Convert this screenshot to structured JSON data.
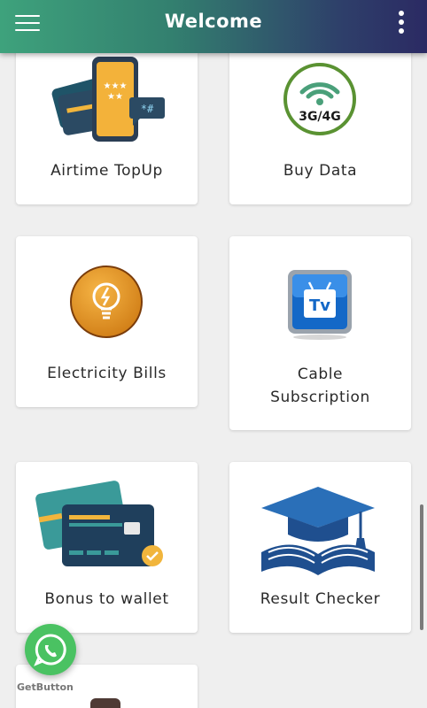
{
  "header": {
    "title": "Welcome",
    "menu_icon": "hamburger-menu-icon",
    "more_icon": "more-vert-icon"
  },
  "services": [
    {
      "label": "Airtime TopUp",
      "icon": "airtime-phone-icon"
    },
    {
      "label": "Buy Data",
      "icon": "data-3g4g-icon",
      "icon_text": "3G/4G"
    },
    {
      "label": "Electricity Bills",
      "icon": "electricity-bulb-icon"
    },
    {
      "label_line1": "Cable",
      "label_line2": "Subscription",
      "icon": "cable-tv-icon",
      "icon_text": "Tv"
    },
    {
      "label": "Bonus to wallet",
      "icon": "bonus-card-icon"
    },
    {
      "label": "Result Checker",
      "icon": "graduation-book-icon"
    }
  ],
  "whatsapp": {
    "icon": "whatsapp-icon",
    "branding": "GetButton"
  },
  "colors": {
    "header_start": "#3ea27c",
    "header_end": "#2b2a63",
    "whatsapp_green": "#4ac262"
  }
}
